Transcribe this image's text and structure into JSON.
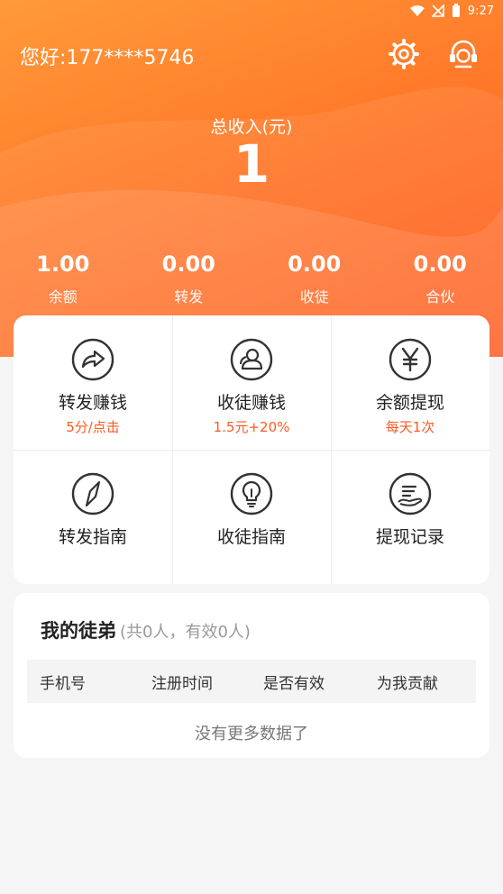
{
  "status_bar": {
    "time": "9:27"
  },
  "header": {
    "greeting": "您好:177****5746",
    "settings_icon": "gear-icon",
    "service_icon": "headset-icon"
  },
  "total": {
    "label": "总收入(元)",
    "value": "1"
  },
  "stats": [
    {
      "value": "1.00",
      "label": "余额"
    },
    {
      "value": "0.00",
      "label": "转发"
    },
    {
      "value": "0.00",
      "label": "收徒"
    },
    {
      "value": "0.00",
      "label": "合伙"
    }
  ],
  "menu": [
    {
      "title": "转发赚钱",
      "sub": "5分/点击",
      "icon": "share-icon"
    },
    {
      "title": "收徒赚钱",
      "sub": "1.5元+20%",
      "icon": "user-icon"
    },
    {
      "title": "余额提现",
      "sub": "每天1次",
      "icon": "yen-icon"
    },
    {
      "title": "转发指南",
      "sub": "",
      "icon": "compass-icon"
    },
    {
      "title": "收徒指南",
      "sub": "",
      "icon": "lightbulb-icon"
    },
    {
      "title": "提现记录",
      "sub": "",
      "icon": "record-icon"
    }
  ],
  "apprentices": {
    "title": "我的徒弟",
    "summary": "(共0人，有效0人)",
    "columns": [
      "手机号",
      "注册时间",
      "是否有效",
      "为我贡献"
    ],
    "empty_text": "没有更多数据了"
  },
  "colors": {
    "accent": "#ff5a1f",
    "gradient_start": "#ff9a3a",
    "gradient_end": "#ff5a1f"
  }
}
